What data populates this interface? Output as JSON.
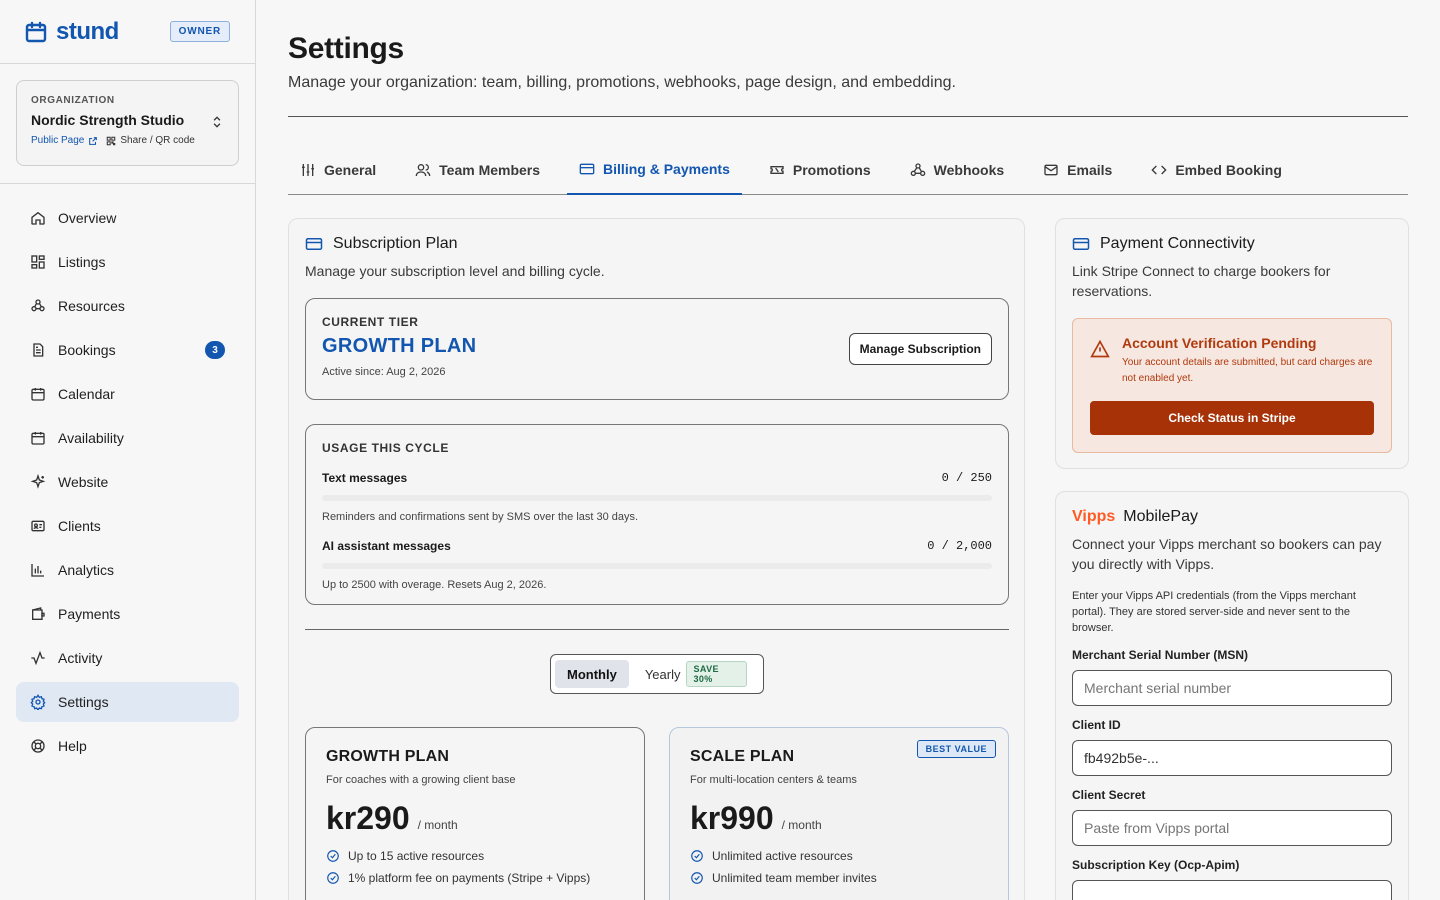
{
  "brand": {
    "name": "stund",
    "role_badge": "OWNER"
  },
  "org": {
    "label": "ORGANIZATION",
    "name": "Nordic Strength Studio",
    "public_page": "Public Page",
    "share": "Share / QR code"
  },
  "nav": [
    {
      "label": "Overview",
      "icon": "home-icon"
    },
    {
      "label": "Listings",
      "icon": "grid-icon"
    },
    {
      "label": "Resources",
      "icon": "network-icon"
    },
    {
      "label": "Bookings",
      "icon": "document-icon",
      "badge": "3"
    },
    {
      "label": "Calendar",
      "icon": "calendar-icon"
    },
    {
      "label": "Availability",
      "icon": "calendar-grid-icon"
    },
    {
      "label": "Website",
      "icon": "sparkles-icon"
    },
    {
      "label": "Clients",
      "icon": "contact-card-icon"
    },
    {
      "label": "Analytics",
      "icon": "bar-chart-icon"
    },
    {
      "label": "Payments",
      "icon": "wallet-icon"
    },
    {
      "label": "Activity",
      "icon": "activity-icon"
    },
    {
      "label": "Settings",
      "icon": "gear-icon",
      "active": true
    },
    {
      "label": "Help",
      "icon": "lifebuoy-icon"
    }
  ],
  "page": {
    "title": "Settings",
    "subtitle": "Manage your organization: team, billing, promotions, webhooks, page design, and embedding."
  },
  "tabs": [
    "General",
    "Team Members",
    "Billing & Payments",
    "Promotions",
    "Webhooks",
    "Emails",
    "Embed Booking"
  ],
  "active_tab": "Billing & Payments",
  "subscription": {
    "title": "Subscription Plan",
    "subtitle": "Manage your subscription level and billing cycle.",
    "current_label": "CURRENT TIER",
    "current_name": "GROWTH PLAN",
    "active_since": "Active since: Aug 2, 2026",
    "manage_button": "Manage Subscription",
    "usage_label": "USAGE THIS CYCLE",
    "usage": [
      {
        "name": "Text messages",
        "value": "0 / 250",
        "fraction": 0,
        "note": "Reminders and confirmations sent by SMS over the last 30 days."
      },
      {
        "name": "AI assistant messages",
        "value": "0 / 2,000",
        "fraction": 0,
        "note": "Up to 2500 with overage. Resets Aug 2, 2026."
      }
    ],
    "billing_toggle": {
      "monthly": "Monthly",
      "yearly": "Yearly",
      "save": "SAVE 30%",
      "selected": "Monthly"
    },
    "plans": [
      {
        "name": "GROWTH PLAN",
        "desc": "For coaches with a growing client base",
        "price": "kr290",
        "per": "/ month",
        "features": [
          "Up to 15 active resources",
          "1% platform fee on payments (Stripe + Vipps)"
        ]
      },
      {
        "name": "SCALE PLAN",
        "desc": "For multi-location centers & teams",
        "price": "kr990",
        "per": "/ month",
        "badge": "BEST VALUE",
        "features": [
          "Unlimited active resources",
          "Unlimited team member invites"
        ]
      }
    ]
  },
  "payment_connectivity": {
    "title": "Payment Connectivity",
    "subtitle": "Link Stripe Connect to charge bookers for reservations.",
    "alert_title": "Account Verification Pending",
    "alert_text": "Your account details are submitted, but card charges are not enabled yet.",
    "button": "Check Status in Stripe",
    "accent": "#a83208"
  },
  "vipps": {
    "logo": "Vipps",
    "title": "MobilePay",
    "subtitle": "Connect your Vipps merchant so bookers can pay you directly with Vipps.",
    "fine": "Enter your Vipps API credentials (from the Vipps merchant portal). They are stored server-side and never sent to the browser.",
    "fields": [
      {
        "label": "Merchant Serial Number (MSN)",
        "placeholder": "Merchant serial number",
        "value": ""
      },
      {
        "label": "Client ID",
        "placeholder": "",
        "value": "fb492b5e-..."
      },
      {
        "label": "Client Secret",
        "placeholder": "Paste from Vipps portal",
        "value": ""
      },
      {
        "label": "Subscription Key (Ocp-Apim)",
        "placeholder": "",
        "value": ""
      }
    ],
    "brand_color": "#ff5b24"
  },
  "colors": {
    "accent": "#1256b0",
    "danger": "#a83208"
  }
}
